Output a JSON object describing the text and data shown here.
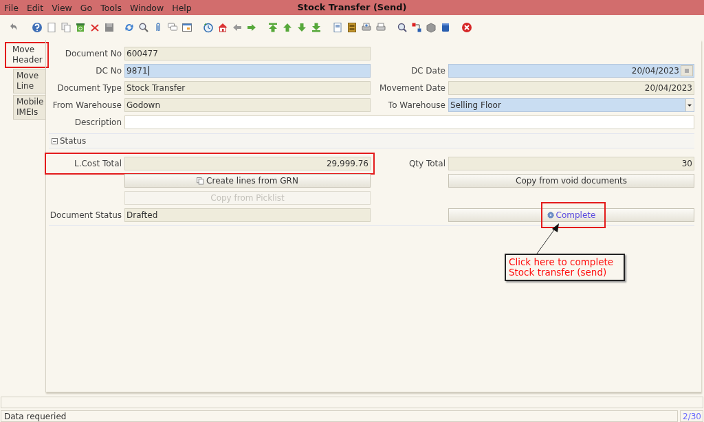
{
  "window": {
    "title": "Stock Transfer (Send)"
  },
  "menu": [
    {
      "label": "File"
    },
    {
      "label": "Edit"
    },
    {
      "label": "View"
    },
    {
      "label": "Go"
    },
    {
      "label": "Tools"
    },
    {
      "label": "Window"
    },
    {
      "label": "Help"
    }
  ],
  "tabs": [
    {
      "label": "Move Header",
      "selected": true,
      "highlighted": true
    },
    {
      "label": "Move Line",
      "selected": false,
      "highlighted": false
    },
    {
      "label": "Mobile IMEIs",
      "selected": false,
      "highlighted": false
    }
  ],
  "header_rows": [
    {
      "left": {
        "kind": "text",
        "label": "Document No",
        "value": "600477",
        "readonly": true,
        "mandatory": false,
        "focused": false
      }
    },
    {
      "left": {
        "kind": "text",
        "label": "DC No",
        "value": "9871",
        "readonly": false,
        "mandatory": true,
        "focused": true
      },
      "right": {
        "kind": "date",
        "label": "DC Date",
        "value": "20/04/2023",
        "readonly": false,
        "mandatory": true,
        "focused": false
      }
    },
    {
      "left": {
        "kind": "text",
        "label": "Document Type",
        "value": "Stock Transfer",
        "readonly": true,
        "mandatory": false,
        "focused": false
      },
      "right": {
        "kind": "number",
        "label": "Movement Date",
        "value": "20/04/2023",
        "readonly": true,
        "mandatory": false,
        "focused": false
      }
    },
    {
      "left": {
        "kind": "text",
        "label": "From Warehouse",
        "value": "Godown",
        "readonly": true,
        "mandatory": false,
        "focused": false
      },
      "right": {
        "kind": "select",
        "label": "To Warehouse",
        "value": "Selling Floor",
        "readonly": false,
        "mandatory": true,
        "focused": false
      }
    },
    {
      "wide": {
        "kind": "text",
        "label": "Description",
        "readonly": false,
        "mandatory": false,
        "focused": false
      }
    }
  ],
  "status_section": {
    "title": "Status",
    "expanded": true,
    "rows": [
      {
        "left": {
          "kind": "number",
          "label": "L.Cost Total",
          "value": "29,999.76",
          "readonly": true,
          "mandatory": false,
          "focused": false,
          "highlighted": true
        },
        "right": {
          "kind": "number",
          "label": "Qty Total",
          "value": "30",
          "readonly": true,
          "mandatory": false,
          "focused": false,
          "highlighted": false
        }
      },
      {
        "left": {
          "kind": "copier",
          "label": "Create lines from GRN",
          "disabled": false,
          "highlighted": false
        },
        "right": {
          "kind": "button",
          "label": "Copy from void documents",
          "disabled": false,
          "highlighted": false
        }
      },
      {
        "left": {
          "kind": "button",
          "label": "Copy from Picklist",
          "disabled": true,
          "highlighted": false
        }
      },
      {
        "left": {
          "kind": "text",
          "label": "Document Status",
          "value": "Drafted",
          "readonly": true,
          "mandatory": false,
          "focused": false,
          "highlighted": false
        },
        "right": {
          "kind": "process",
          "label": "Complete",
          "disabled": false,
          "highlighted": true
        }
      }
    ]
  },
  "annotation": {
    "lines": [
      "Click here to complete",
      "Stock transfer (send)"
    ]
  },
  "status_bar": {
    "message": "Data requeried",
    "record": "2/30"
  }
}
